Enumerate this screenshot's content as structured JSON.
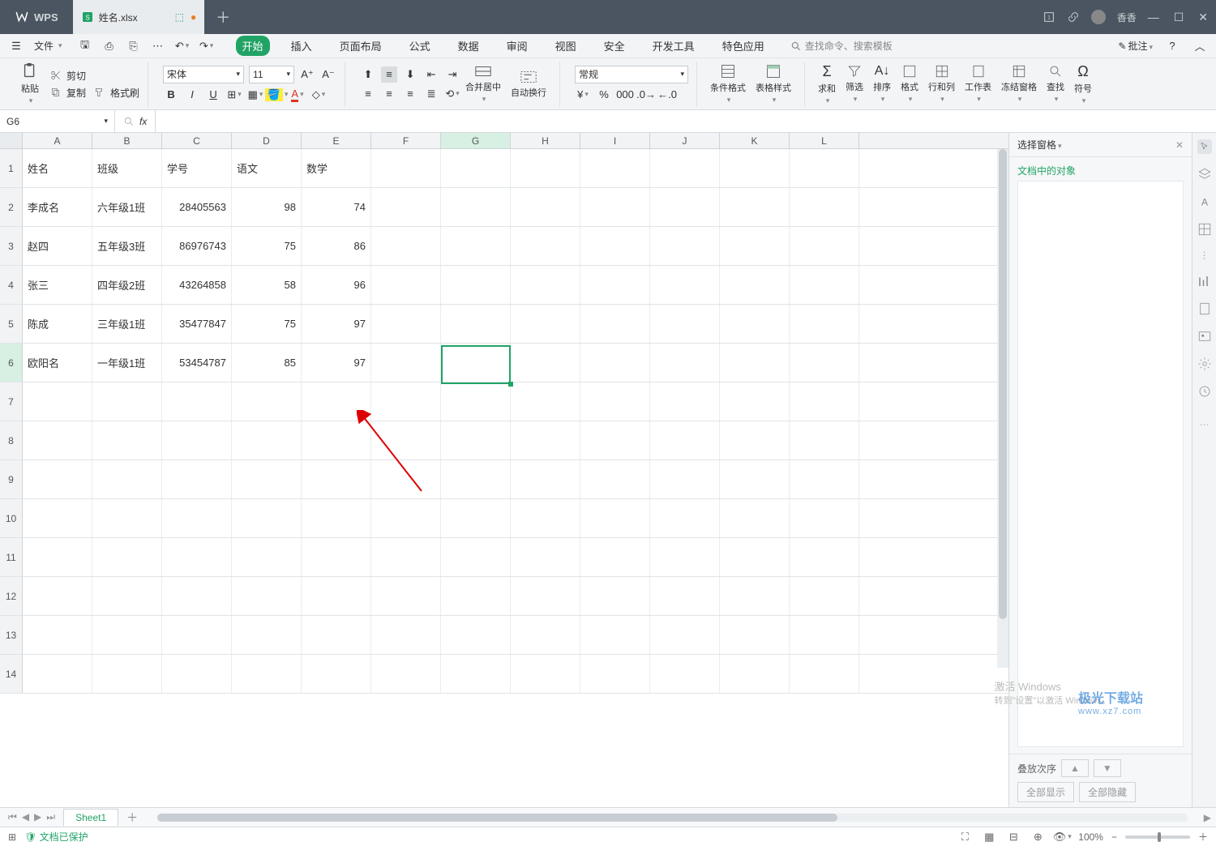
{
  "app": {
    "name": "WPS",
    "user": "香香"
  },
  "tab": {
    "filename": "姓名.xlsx"
  },
  "file_menu": "文件",
  "ribbon_tabs": [
    "开始",
    "插入",
    "页面布局",
    "公式",
    "数据",
    "审阅",
    "视图",
    "安全",
    "开发工具",
    "特色应用"
  ],
  "active_tab": "开始",
  "search_placeholder": "查找命令、搜索模板",
  "note_btn": "批注",
  "clipboard": {
    "paste": "粘贴",
    "cut": "剪切",
    "copy": "复制",
    "fmt": "格式刷"
  },
  "font": {
    "name": "宋体",
    "size": "11"
  },
  "merge": "合并居中",
  "wrap": "自动换行",
  "number_format": "常规",
  "cond_fmt": "条件格式",
  "tbl_style": "表格样式",
  "sum": "求和",
  "filter": "筛选",
  "sort": "排序",
  "format": "格式",
  "rowcol": "行和列",
  "worksheet": "工作表",
  "freeze": "冻结窗格",
  "find": "查找",
  "symbol": "符号",
  "namebox": "G6",
  "columns": [
    "A",
    "B",
    "C",
    "D",
    "E",
    "F",
    "G",
    "H",
    "I",
    "J",
    "K",
    "L"
  ],
  "row_headers": [
    "1",
    "2",
    "3",
    "4",
    "5",
    "6",
    "7",
    "8",
    "9",
    "10",
    "11",
    "12",
    "13",
    "14"
  ],
  "header_row": {
    "A": "姓名",
    "B": "班级",
    "C": "学号",
    "D": "语文",
    "E": "数学"
  },
  "data_rows": [
    {
      "A": "李成名",
      "B": "六年级1班",
      "C": "28405563",
      "D": "98",
      "E": "74"
    },
    {
      "A": "赵四",
      "B": "五年级3班",
      "C": "86976743",
      "D": "75",
      "E": "86"
    },
    {
      "A": "张三",
      "B": "四年级2班",
      "C": "43264858",
      "D": "58",
      "E": "96"
    },
    {
      "A": "陈成",
      "B": "三年级1班",
      "C": "35477847",
      "D": "75",
      "E": "97"
    },
    {
      "A": "欧阳名",
      "B": "一年级1班",
      "C": "53454787",
      "D": "85",
      "E": "97"
    }
  ],
  "selected_cell": "G6",
  "right_panel": {
    "head": "选择窗格",
    "title": "文档中的对象",
    "stack_order": "叠放次序",
    "show_all": "全部显示",
    "hide_all": "全部隐藏"
  },
  "sheet_name": "Sheet1",
  "protect": "文档已保护",
  "zoom": "100%",
  "activate": {
    "l1": "激活 Windows",
    "l2": "转到\"设置\"以激活 Windows。"
  },
  "watermark": {
    "l1": "极光下载站",
    "l2": "www.xz7.com"
  }
}
